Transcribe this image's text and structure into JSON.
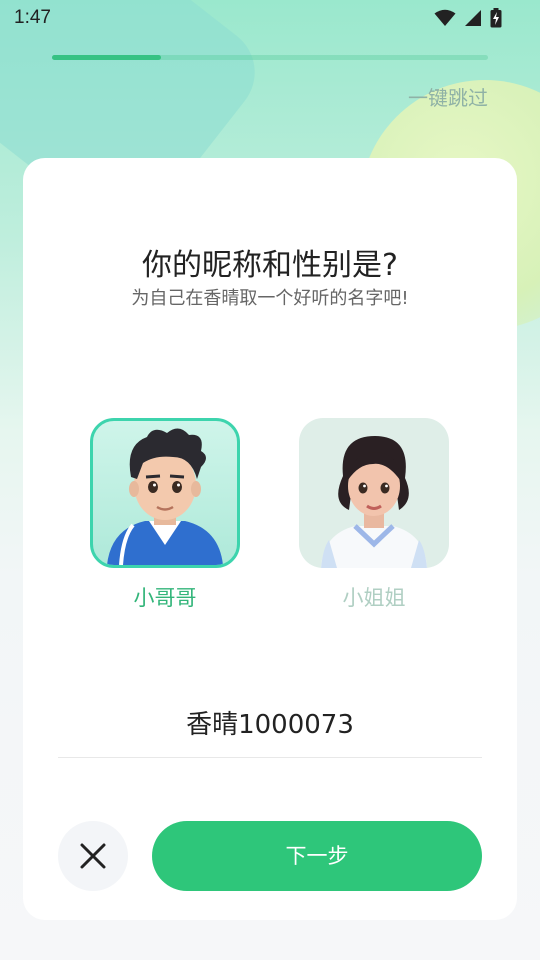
{
  "status_bar": {
    "time": "1:47",
    "icons": [
      "wifi-icon",
      "signal-icon",
      "battery-charging-icon"
    ]
  },
  "progress": {
    "fraction": 0.25,
    "color": "#36c283"
  },
  "skip_label": "一键跳过",
  "card": {
    "title": "你的昵称和性别是?",
    "subtitle": "为自己在香晴取一个好听的名字吧!"
  },
  "genders": [
    {
      "label": "小哥哥",
      "selected": true,
      "color": "#33b57a"
    },
    {
      "label": "小姐姐",
      "selected": false,
      "color": "#b0cfc3"
    }
  ],
  "nickname": {
    "value": "香晴1000073"
  },
  "actions": {
    "close_icon": "close-icon",
    "next_label": "下一步",
    "next_color": "#2ec67a"
  }
}
